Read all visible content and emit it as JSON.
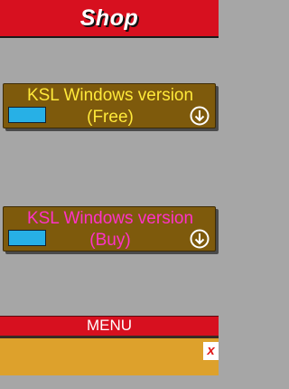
{
  "header": {
    "title": "Shop"
  },
  "products": [
    {
      "title_line1": "KSL Windows version",
      "title_line2": "(Free)"
    },
    {
      "title_line1": "KSL Windows version",
      "title_line2": "(Buy)"
    }
  ],
  "icons": {
    "download": "download-arrow-icon",
    "close": "close-icon"
  },
  "menu": {
    "label": "MENU"
  },
  "ad": {
    "close_label": "x"
  },
  "colors": {
    "header_bg": "#d7101f",
    "card_bg": "#7e5a0c",
    "free_title": "#ffe93a",
    "buy_title": "#ff32c8",
    "thumb": "#27b0e6",
    "ad_bg": "#dda12c"
  }
}
